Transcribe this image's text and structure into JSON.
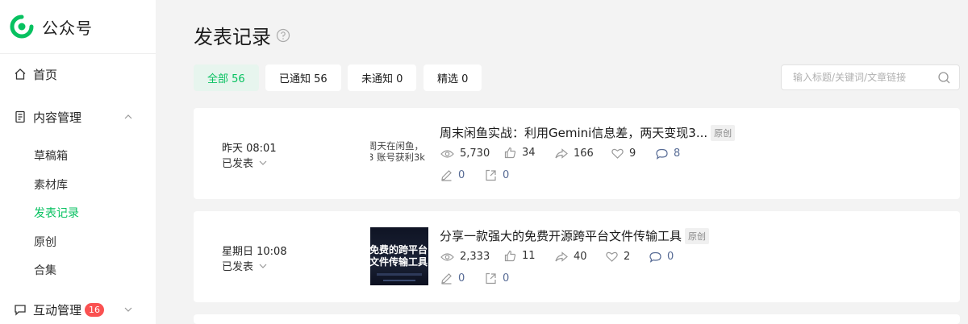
{
  "sidebar": {
    "logo_text": "公众号",
    "home": "首页",
    "content": "内容管理",
    "sub": [
      "草稿箱",
      "素材库",
      "发表记录",
      "原创",
      "合集"
    ],
    "interact": "互动管理",
    "interact_badge": "16"
  },
  "page": {
    "title": "发表记录"
  },
  "tabs": [
    "全部 56",
    "已通知 56",
    "未通知 0",
    "精选 0"
  ],
  "search": {
    "placeholder": "输入标题/关键词/文章链接"
  },
  "articles": [
    {
      "time": "昨天 08:01",
      "status": "已发表",
      "thumb_lines": [
        "周天在闲鱼，",
        "3 账号获利3k"
      ],
      "title": "周末闲鱼实战：利用Gemini信息差，两天变现3...",
      "tag": "原创",
      "views": "5,730",
      "likes": "34",
      "shares": "166",
      "favs": "9",
      "comments": "8",
      "edits": "0",
      "reposts": "0"
    },
    {
      "time": "星期日 10:08",
      "status": "已发表",
      "thumb_lines": [
        "免费的跨平台",
        "文件传输工具"
      ],
      "title": "分享一款强大的免费开源跨平台文件传输工具",
      "tag": "原创",
      "views": "2,333",
      "likes": "11",
      "shares": "40",
      "favs": "2",
      "comments": "0",
      "edits": "0",
      "reposts": "0"
    }
  ],
  "colors": {
    "accent": "#07c160",
    "badge": "#fa5151",
    "link": "#576b95"
  }
}
